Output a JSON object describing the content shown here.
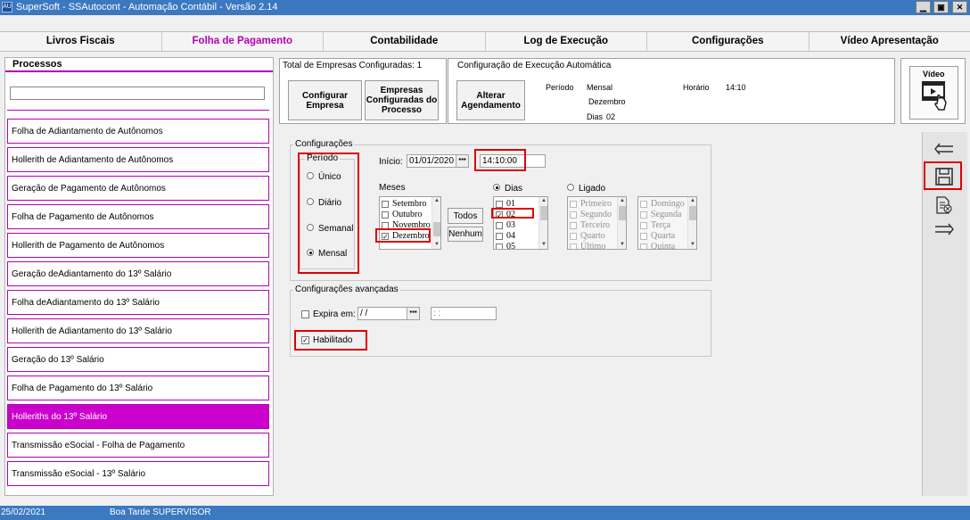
{
  "window": {
    "icon_text": "AU",
    "title": "SuperSoft - SSAutocont - Automação Contábil - Versão 2.14",
    "minimize": "▁",
    "maximize": "▣",
    "close": "✕"
  },
  "menu": [
    {
      "label": "Livros Fiscais",
      "active": false
    },
    {
      "label": "Folha de Pagamento",
      "active": true
    },
    {
      "label": "Contabilidade",
      "active": false
    },
    {
      "label": "Log de Execução",
      "active": false
    },
    {
      "label": "Configurações",
      "active": false
    },
    {
      "label": "Vídeo Apresentação",
      "active": false
    }
  ],
  "processes": {
    "header": "Processos",
    "search_value": "",
    "items": [
      "Folha de Adiantamento de Autônomos",
      "Hollerith de Adiantamento de Autônomos",
      "Geração de Pagamento de Autônomos",
      "Folha de Pagamento de Autônomos",
      "Hollerith de Pagamento de Autônomos",
      "Geração deAdiantamento do 13º Salário",
      "Folha deAdiantamento do 13º Salário",
      "Hollerith de Adiantamento do 13º Salário",
      "Geração do 13º Salário",
      "Folha de Pagamento do 13º Salário",
      "Holleriths do 13º Salário",
      "Transmissão eSocial - Folha de Pagamento",
      "Transmissão eSocial - 13º Salário"
    ],
    "selected_index": 10
  },
  "companies": {
    "total_label": "Total de Empresas Configuradas: 1",
    "configure_button": "Configurar Empresa",
    "configured_button": "Empresas Configuradas do Processo"
  },
  "auto_exec": {
    "title": "Configuração de Execução Automática",
    "change_button": "Alterar Agendamento",
    "periodo_label": "Período",
    "periodo_value": "Mensal",
    "mes_value": "Dezembro",
    "dias_label": "Dias",
    "dias_value": "02",
    "horario_label": "Horário",
    "horario_value": "14:10"
  },
  "video_button": "Vídeo",
  "config": {
    "group_label": "Configurações",
    "periodo_group": "Período",
    "periodo_options": [
      {
        "label": "Único",
        "checked": false
      },
      {
        "label": "Diário",
        "checked": false
      },
      {
        "label": "Semanal",
        "checked": false
      },
      {
        "label": "Mensal",
        "checked": true
      }
    ],
    "inicio_label": "Início:",
    "inicio_value": "01/01/2020",
    "time_value": "14:10:00",
    "meses_label": "Meses",
    "meses": [
      {
        "label": "Setembro",
        "checked": false
      },
      {
        "label": "Outubro",
        "checked": false
      },
      {
        "label": "Novembro",
        "checked": false
      },
      {
        "label": "Dezembro",
        "checked": true
      }
    ],
    "todos_button": "Todos",
    "nenhum_button": "Nenhum",
    "dias_radio": "Dias",
    "dias": [
      {
        "label": "01",
        "checked": false
      },
      {
        "label": "02",
        "checked": true
      },
      {
        "label": "03",
        "checked": false
      },
      {
        "label": "04",
        "checked": false
      },
      {
        "label": "05",
        "checked": false
      }
    ],
    "ligado_radio": "Ligado",
    "ordinals": [
      "Primeiro",
      "Segundo",
      "Terceiro",
      "Quarto",
      "Último"
    ],
    "weekdays": [
      "Domingo",
      "Segunda",
      "Terça",
      "Quarta",
      "Quinta"
    ]
  },
  "advanced": {
    "group_label": "Configurações avançadas",
    "expira_label": "Expira em:",
    "expira_date": " / /",
    "expira_time": " :  :",
    "habilitado_label": "Habilitado",
    "habilitado_checked": true
  },
  "status": {
    "date": "25/02/2021",
    "greeting": "Boa Tarde SUPERVISOR"
  },
  "colors": {
    "accent": "#b400b4",
    "selected_bg": "#cc00cc",
    "titlebar": "#3c78c0",
    "highlight": "#e00000"
  }
}
